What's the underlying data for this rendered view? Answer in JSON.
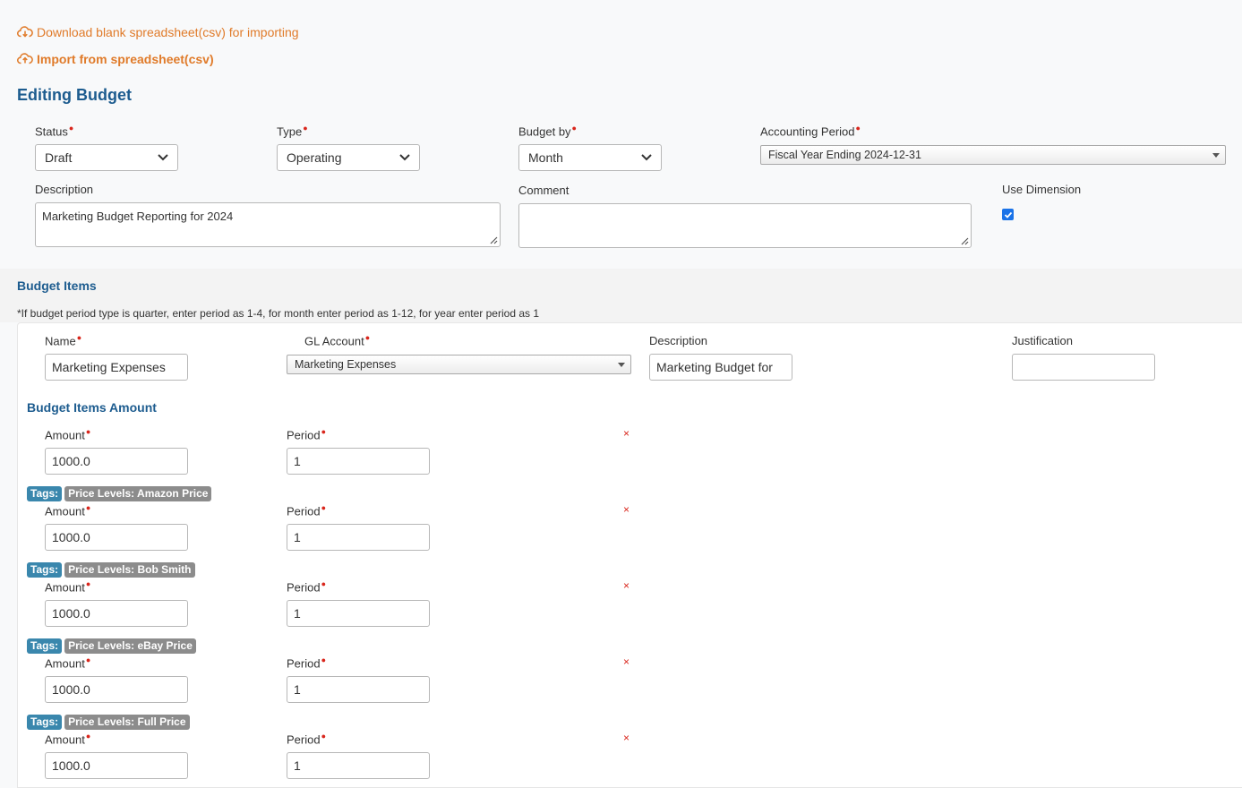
{
  "links": {
    "download": "Download blank spreadsheet(csv) for importing",
    "import": "Import from spreadsheet(csv)"
  },
  "page_title": "Editing Budget",
  "form": {
    "status": {
      "label": "Status",
      "value": "Draft"
    },
    "type": {
      "label": "Type",
      "value": "Operating"
    },
    "budget_by": {
      "label": "Budget by",
      "value": "Month"
    },
    "accounting_period": {
      "label": "Accounting Period",
      "value": "Fiscal Year Ending 2024-12-31"
    },
    "description": {
      "label": "Description",
      "value": "Marketing Budget Reporting for 2024"
    },
    "comment": {
      "label": "Comment",
      "value": ""
    },
    "use_dimension": {
      "label": "Use Dimension",
      "checked": true
    }
  },
  "budget_items": {
    "title": "Budget Items",
    "note": "*If budget period type is quarter, enter period as 1-4, for month enter period as 1-12, for year enter period as 1",
    "item": {
      "name_label": "Name",
      "name_value": "Marketing Expenses",
      "gl_label": "GL Account",
      "gl_value": "Marketing Expenses",
      "desc_label": "Description",
      "desc_value": "Marketing Budget for",
      "just_label": "Justification",
      "just_value": ""
    },
    "amounts_title": "Budget Items Amount",
    "amount_label": "Amount",
    "period_label": "Period",
    "remove_glyph": "×",
    "amounts": [
      {
        "amount": "1000.0",
        "period": "1"
      },
      {
        "amount": "1000.0",
        "period": "1"
      },
      {
        "amount": "1000.0",
        "period": "1"
      },
      {
        "amount": "1000.0",
        "period": "1"
      },
      {
        "amount": "1000.0",
        "period": "1"
      }
    ],
    "tag_key": "Tags:",
    "tags": [
      "Price Levels: Amazon Price",
      "Price Levels: Bob Smith",
      "Price Levels: eBay Price",
      "Price Levels: Full Price"
    ]
  },
  "colors": {
    "link": "#e07b2a",
    "heading": "#1d5c8f",
    "required": "#d9261c",
    "tag_key": "#3a87ad",
    "tag_value": "#8c8c8c"
  },
  "icons": {
    "download": "cloud-download-icon",
    "upload": "cloud-upload-icon",
    "dropdown": "chevron-down-icon",
    "remove": "close-icon"
  }
}
